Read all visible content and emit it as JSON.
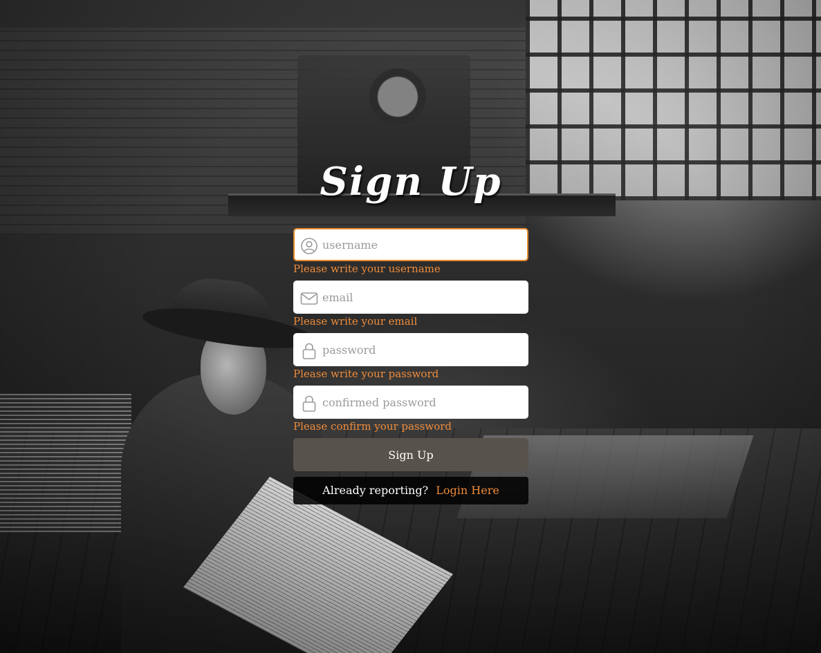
{
  "page": {
    "title": "Sign Up"
  },
  "fields": {
    "username": {
      "placeholder": "username",
      "value": "",
      "icon": "user-circle-icon",
      "error": "Please write your username"
    },
    "email": {
      "placeholder": "email",
      "value": "",
      "icon": "envelope-icon",
      "error": "Please write your email"
    },
    "password": {
      "placeholder": "password",
      "value": "",
      "icon": "lock-icon",
      "error": "Please write your password"
    },
    "confirm_password": {
      "placeholder": "confirmed password",
      "value": "",
      "icon": "lock-icon",
      "error": "Please confirm your password"
    }
  },
  "actions": {
    "submit_label": "Sign Up",
    "login_prompt": "Already reporting?",
    "login_link": "Login Here"
  },
  "colors": {
    "accent": "#e6892d",
    "error_text": "#f08c3a",
    "button_bg": "#58524c",
    "title_text": "#ffffff"
  }
}
